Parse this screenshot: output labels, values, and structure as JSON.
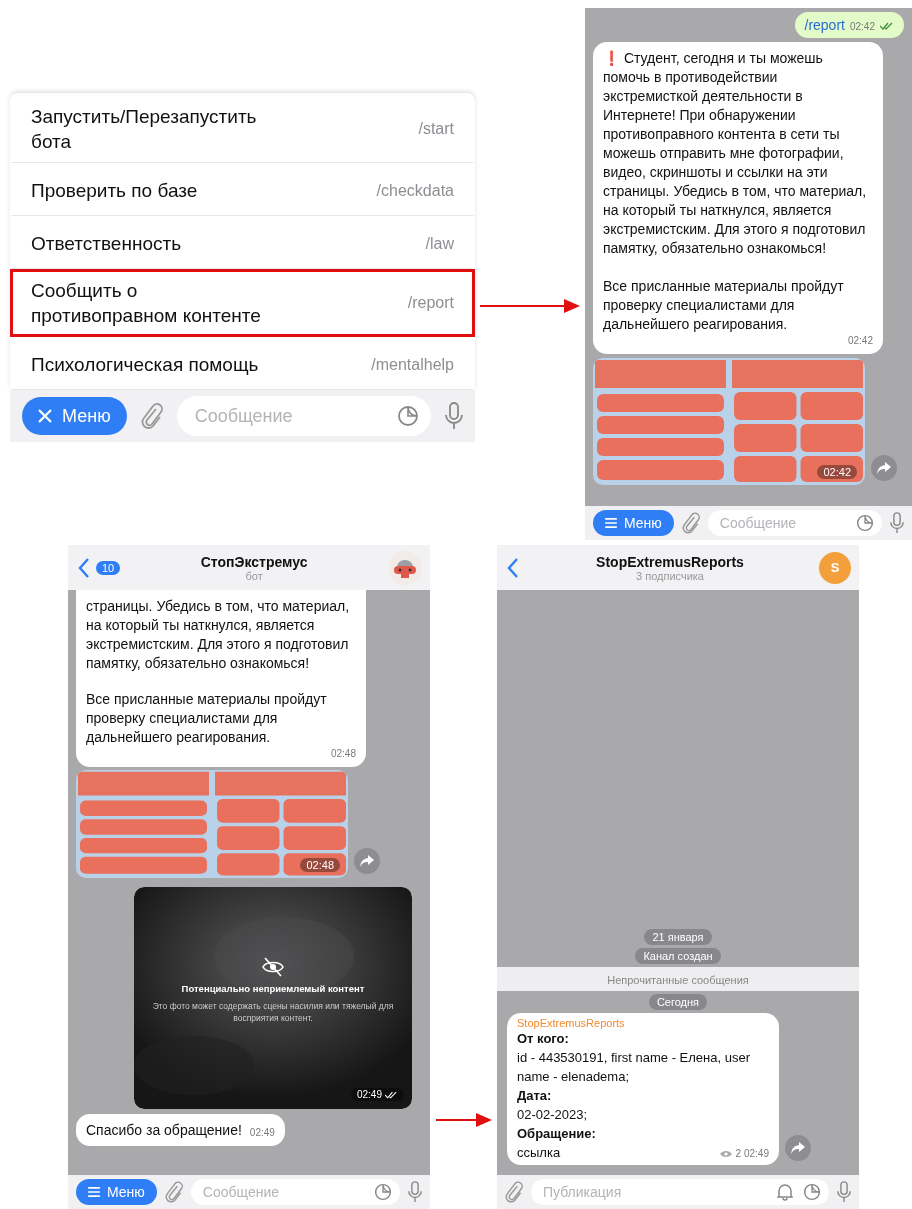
{
  "menu_panel": {
    "items": [
      {
        "label": "Запустить/Перезапустить бота",
        "command": "/start",
        "selected": false
      },
      {
        "label": "Проверить по базе",
        "command": "/checkdata",
        "selected": false
      },
      {
        "label": "Ответственность",
        "command": "/law",
        "selected": false
      },
      {
        "label": "Сообщить о противоправном контенте",
        "command": "/report",
        "selected": true
      },
      {
        "label": "Психологическая помощь",
        "command": "/mentalhelp",
        "selected": false
      }
    ],
    "input_bar": {
      "kind": "bot",
      "menu_button": "Меню",
      "menu_open": true,
      "placeholder": "Сообщение"
    }
  },
  "chats": [
    {
      "messages": [
        {
          "kind": "outgoing",
          "text": "/report",
          "time": "02:42",
          "read": true
        },
        {
          "kind": "incoming",
          "paragraphs": [
            "❗ Студент, сегодня и ты можешь помочь в противодействии экстремисткой деятельности в Интернете! При обнаружении противоправного контента в сети ты можешь отправить мне фотографии, видео, скриншоты и ссылки на эти страницы. Убедись в том, что материал, на который ты наткнулся, является экстремистским. Для этого я подготовил памятку, обязательно ознакомься!",
            "Все присланные материалы пройдут проверку специалистами для дальнейшего реагирования."
          ],
          "time": "02:42"
        },
        {
          "kind": "album",
          "time": "02:42"
        }
      ],
      "input_bar": {
        "kind": "bot",
        "menu_button": "Меню",
        "menu_open": false,
        "placeholder": "Сообщение"
      }
    },
    {
      "header": {
        "title": "СтопЭкстремус",
        "subtitle": "бот",
        "unread": "10"
      },
      "messages": [
        {
          "kind": "incoming",
          "paragraphs": [
            "страницы. Убедись в том, что материал, на который ты наткнулся, является экстремистским. Для этого я подготовил памятку, обязательно ознакомься!",
            "Все присланные материалы пройдут проверку специалистами для дальнейшего реагирования."
          ],
          "time": "02:48"
        },
        {
          "kind": "album",
          "time": "02:48"
        },
        {
          "kind": "sensitive",
          "title": "Потенциально неприемлемый контент",
          "text": "Это фото может содержать сцены насилия или тяжелый для восприятия контент.",
          "time": "02:49",
          "read": true
        },
        {
          "kind": "incoming",
          "paragraphs": [
            "Спасибо за обращение!"
          ],
          "time": "02:49"
        }
      ],
      "input_bar": {
        "kind": "bot",
        "menu_button": "Меню",
        "menu_open": false,
        "placeholder": "Сообщение"
      }
    },
    {
      "header": {
        "title": "StopExtremusReports",
        "subtitle": "3 подписчика",
        "letter": "S"
      },
      "messages": [
        {
          "kind": "date",
          "text": "21 января"
        },
        {
          "kind": "date",
          "text": "Канал создан"
        },
        {
          "kind": "unread_bar",
          "text": "Непрочитанные сообщения"
        },
        {
          "kind": "date",
          "text": "Сегодня"
        },
        {
          "kind": "post",
          "author": "StopExtremusReports",
          "lines": [
            {
              "text": "От кого:",
              "bold": true
            },
            {
              "text": "id - 443530191, first name - Елена, user name - elenadema;",
              "bold": false
            },
            {
              "text": "Дата:",
              "bold": true
            },
            {
              "text": "02-02-2023;",
              "bold": false
            },
            {
              "text": "Обращение:",
              "bold": true
            },
            {
              "text": "ссылка",
              "bold": false
            }
          ],
          "views": "2",
          "time": "02:49"
        }
      ],
      "input_bar": {
        "kind": "channel",
        "placeholder": "Публикация"
      }
    }
  ]
}
